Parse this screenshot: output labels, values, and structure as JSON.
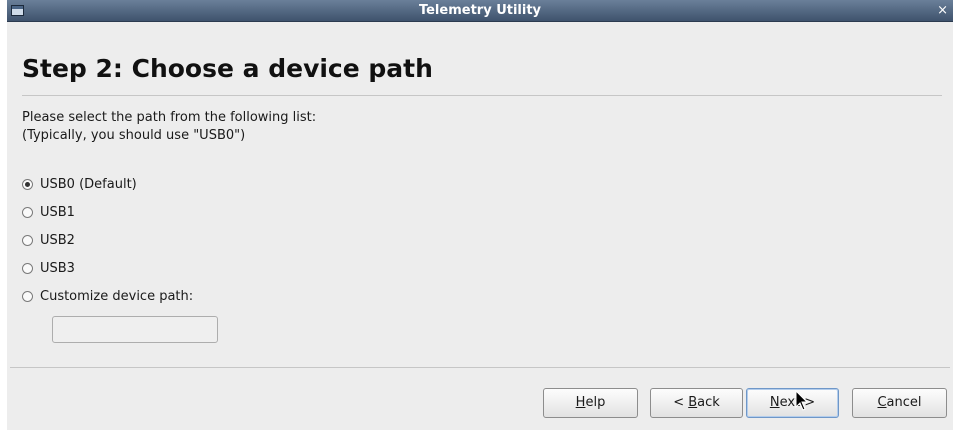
{
  "window": {
    "title": "Telemetry Utility",
    "close_glyph": "×",
    "app_icon": "window-icon",
    "close_icon": "close-icon"
  },
  "page": {
    "heading": "Step 2: Choose a device path",
    "description_line1": "Please select the path from the following list:",
    "description_line2": "(Typically, you should use \"USB0\")"
  },
  "options": [
    {
      "label": "USB0 (Default)",
      "selected": true
    },
    {
      "label": "USB1",
      "selected": false
    },
    {
      "label": "USB2",
      "selected": false
    },
    {
      "label": "USB3",
      "selected": false
    },
    {
      "label": "Customize device path:",
      "selected": false
    }
  ],
  "custom_path": {
    "value": "",
    "placeholder": ""
  },
  "buttons": {
    "help": {
      "mnemonic": "H",
      "rest": "elp"
    },
    "back": {
      "prefix": "< ",
      "mnemonic": "B",
      "rest": "ack"
    },
    "next": {
      "mnemonic": "N",
      "rest": "ext >"
    },
    "cancel": {
      "mnemonic": "C",
      "rest": "ancel"
    }
  },
  "colors": {
    "titlebar_top": "#6a7f99",
    "titlebar_bottom": "#3f536d",
    "window_background": "#ededed",
    "default_button_border": "#6f97c8"
  },
  "icons": {
    "radio_checked": "radio-checked-icon",
    "radio_unchecked": "radio-unchecked-icon",
    "pointer": "mouse-pointer-icon"
  }
}
